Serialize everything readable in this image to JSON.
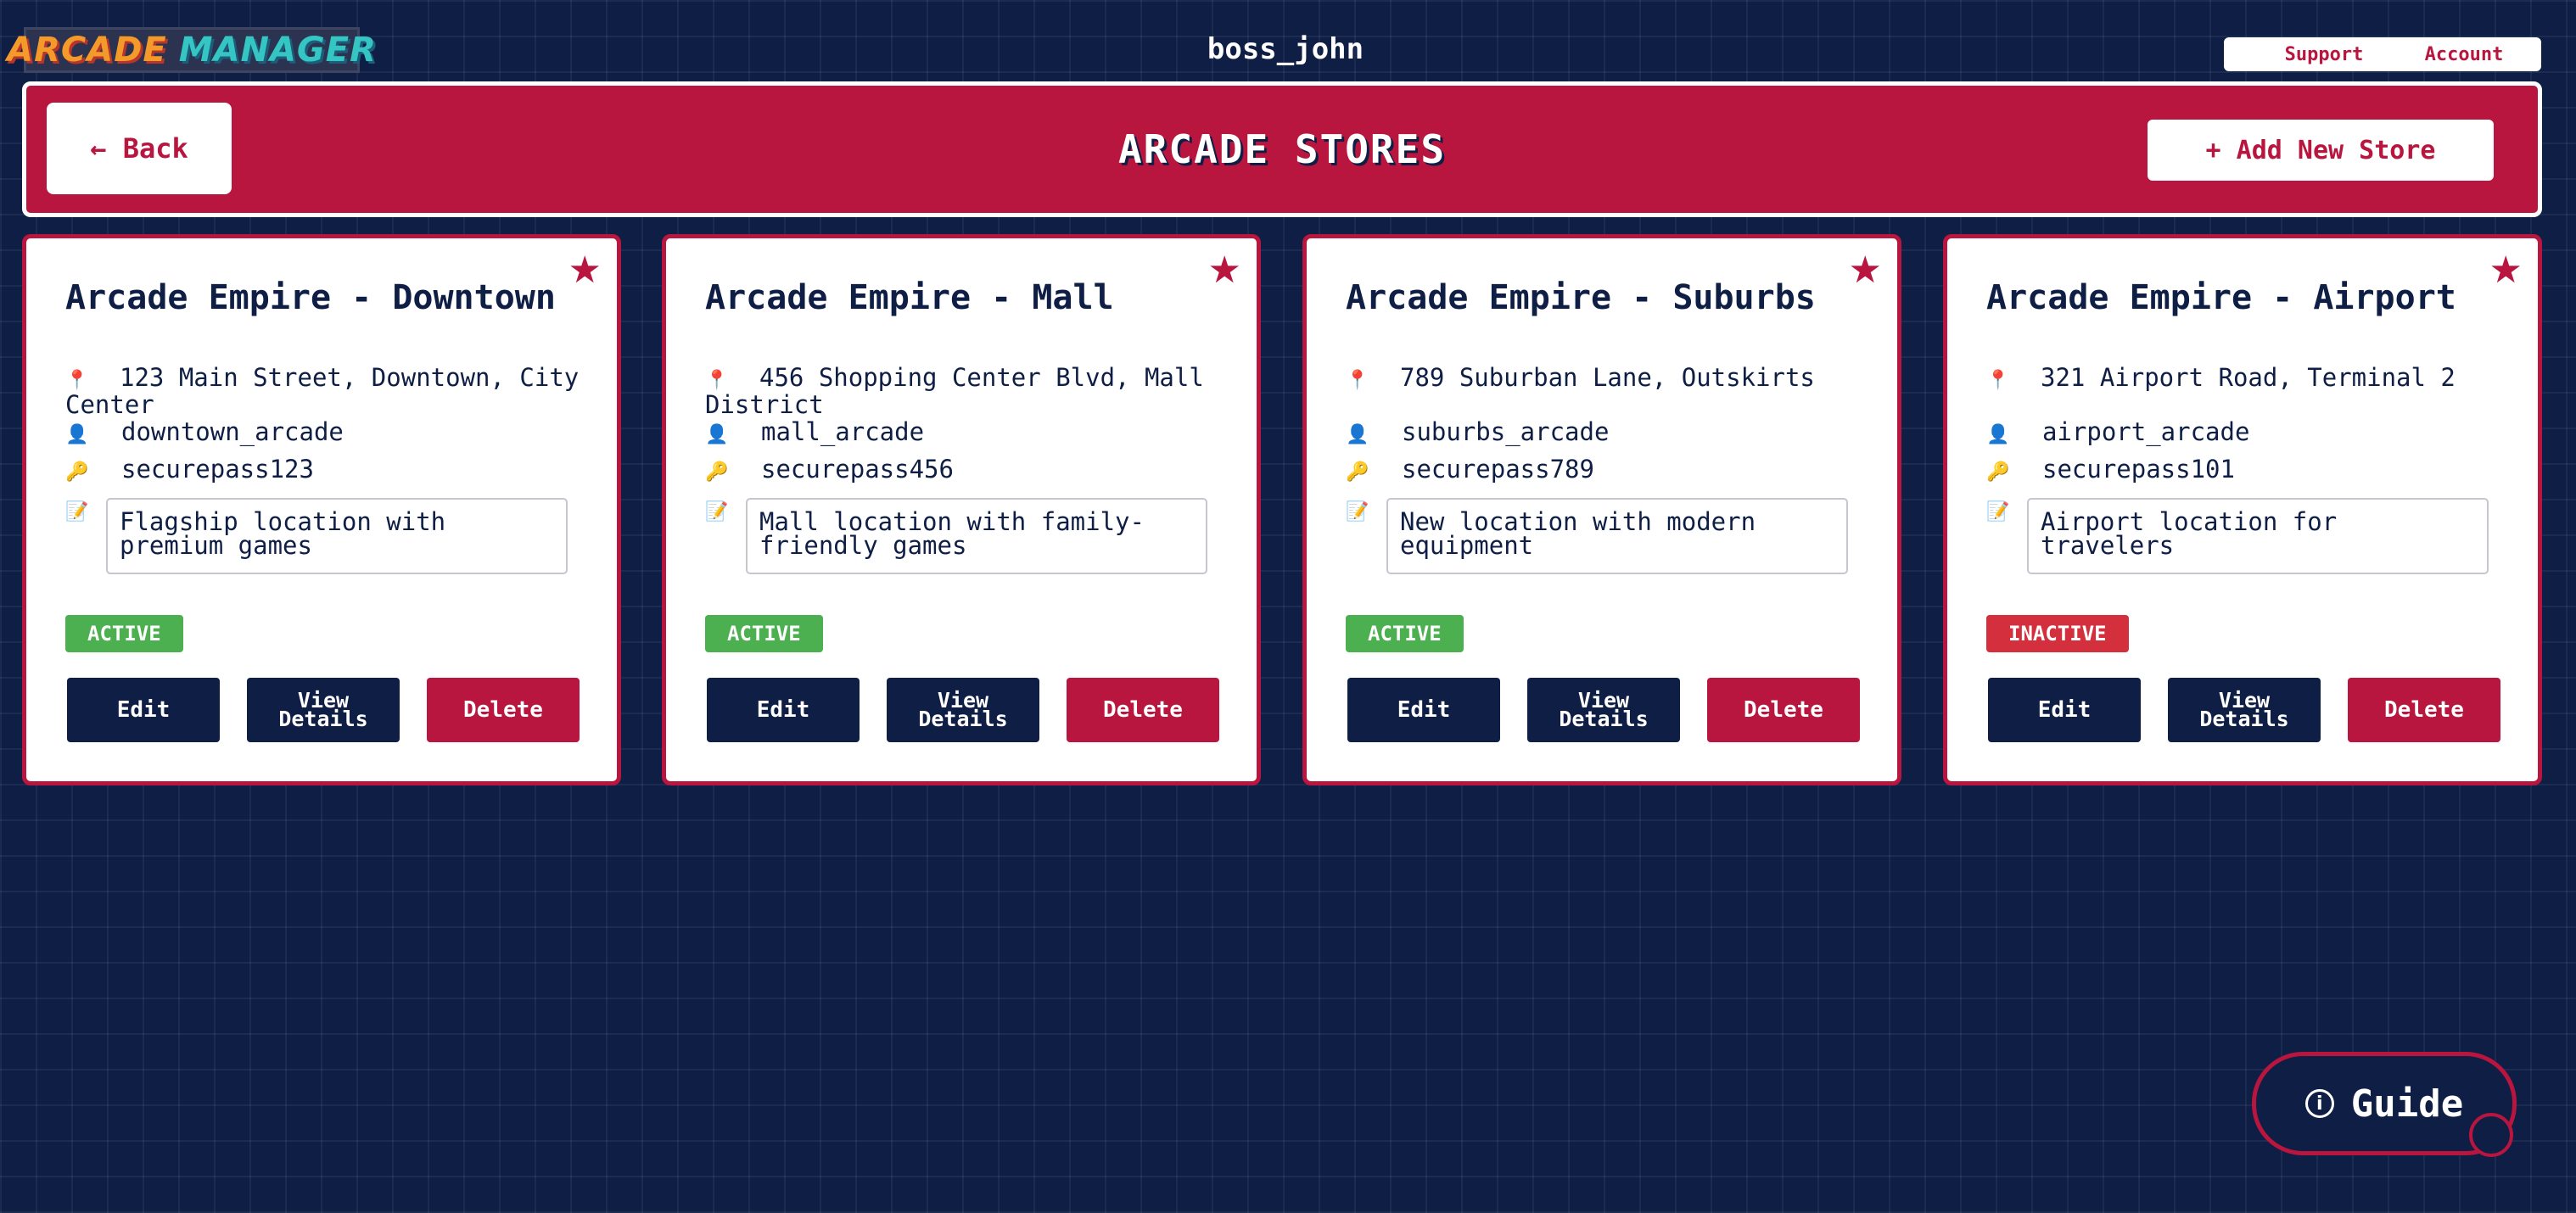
{
  "app": {
    "logo_word1": "ARCADE",
    "logo_word2": "MANAGER",
    "username": "boss_john",
    "support_label": "Support",
    "account_label": "Account"
  },
  "header": {
    "back_label": "← Back",
    "title": "ARCADE STORES",
    "add_label": "+ Add New Store"
  },
  "colors": {
    "background": "#0e1e45",
    "accent": "#b8153f",
    "active": "#4caf50",
    "inactive": "#d32f3c"
  },
  "icons": {
    "location": "location-pin-icon",
    "user": "user-icon",
    "password": "key-icon",
    "notes": "memo-icon",
    "favorite": "star-icon"
  },
  "stores": [
    {
      "name": "Arcade Empire - Downtown",
      "address": "123 Main Street, Downtown, City Center",
      "username": "downtown_arcade",
      "password": "securepass123",
      "notes": "Flagship location with premium games",
      "status": "ACTIVE",
      "edit_label": "Edit",
      "view_label": "View Details",
      "delete_label": "Delete"
    },
    {
      "name": "Arcade Empire - Mall",
      "address": "456 Shopping Center Blvd, Mall District",
      "username": "mall_arcade",
      "password": "securepass456",
      "notes": "Mall location with family-friendly games",
      "status": "ACTIVE",
      "edit_label": "Edit",
      "view_label": "View Details",
      "delete_label": "Delete"
    },
    {
      "name": "Arcade Empire - Suburbs",
      "address": "789 Suburban Lane, Outskirts",
      "username": "suburbs_arcade",
      "password": "securepass789",
      "notes": "New location with modern equipment",
      "status": "ACTIVE",
      "edit_label": "Edit",
      "view_label": "View Details",
      "delete_label": "Delete"
    },
    {
      "name": "Arcade Empire - Airport",
      "address": "321 Airport Road, Terminal 2",
      "username": "airport_arcade",
      "password": "securepass101",
      "notes": "Airport location for travelers",
      "status": "INACTIVE",
      "edit_label": "Edit",
      "view_label": "View Details",
      "delete_label": "Delete"
    }
  ],
  "guide": {
    "label": "Guide"
  }
}
